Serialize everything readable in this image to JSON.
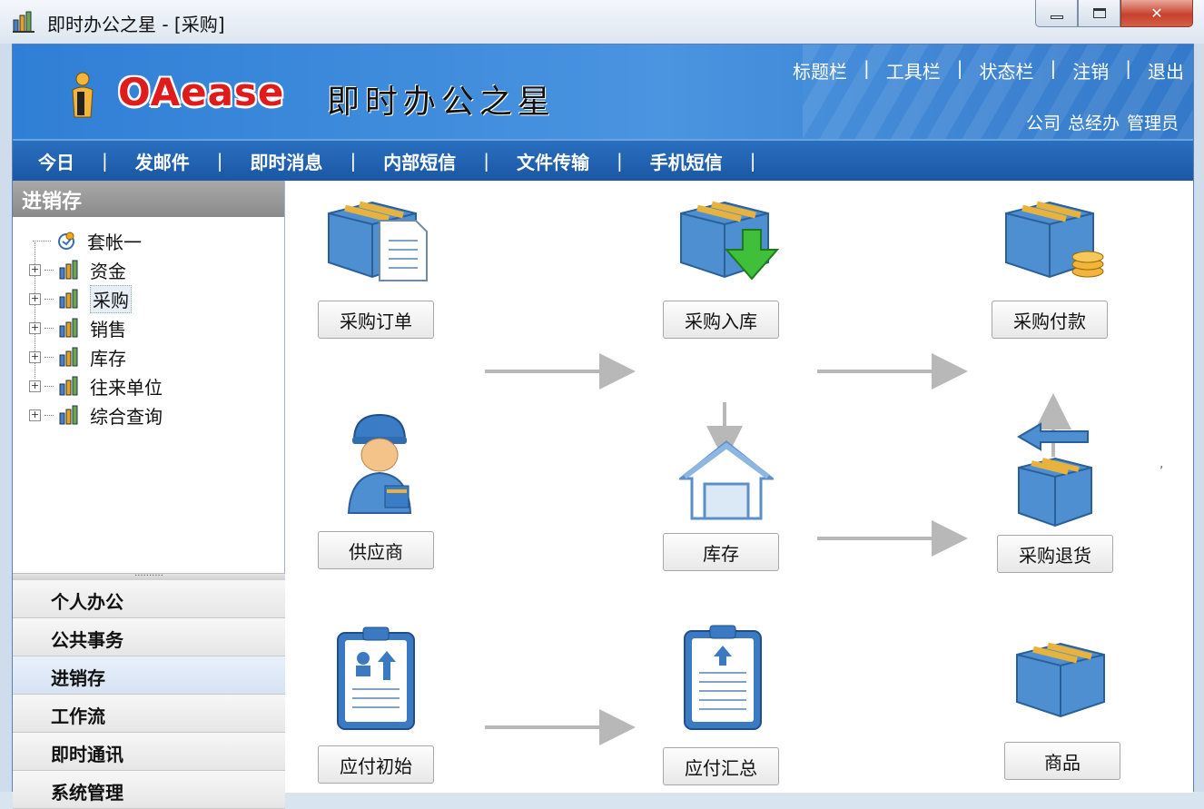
{
  "window": {
    "title": "即时办公之星 - [采购]"
  },
  "banner": {
    "logo_text": "OAease",
    "logo_cn": "即时办公之星",
    "top_menu": [
      "标题栏",
      "工具栏",
      "状态栏",
      "注销",
      "退出"
    ],
    "user_line": [
      "公司",
      "总经办",
      "管理员"
    ]
  },
  "navbar": {
    "items": [
      "今日",
      "发邮件",
      "即时消息",
      "内部短信",
      "文件传输",
      "手机短信"
    ]
  },
  "sidebar": {
    "header": "进销存",
    "tree": [
      {
        "label": "套帐一",
        "expandable": false
      },
      {
        "label": "资金",
        "expandable": true
      },
      {
        "label": "采购",
        "expandable": true,
        "selected": true
      },
      {
        "label": "销售",
        "expandable": true
      },
      {
        "label": "库存",
        "expandable": true
      },
      {
        "label": "往来单位",
        "expandable": true
      },
      {
        "label": "综合查询",
        "expandable": true
      }
    ],
    "outlook": [
      "个人办公",
      "公共事务",
      "进销存",
      "工作流",
      "即时通讯",
      "系统管理"
    ],
    "outlook_active": "进销存"
  },
  "flow": {
    "purchase_order": "采购订单",
    "purchase_in": "采购入库",
    "purchase_pay": "采购付款",
    "supplier": "供应商",
    "stock": "库存",
    "purchase_return": "采购退货",
    "payable_init": "应付初始",
    "payable_summary": "应付汇总",
    "goods": "商品"
  },
  "colors": {
    "banner": "#3a86d8",
    "navbar": "#1f5fae",
    "logo_red": "#e01b1b",
    "arrow": "#b8b8b8"
  }
}
